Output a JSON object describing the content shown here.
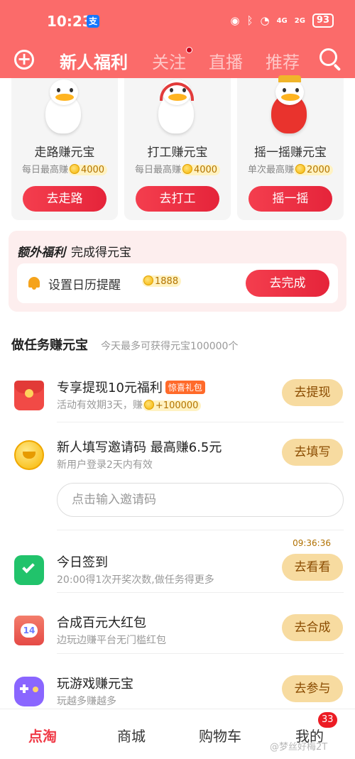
{
  "status_bar": {
    "time": "10:23",
    "alipay": "支",
    "signal_4g": "4G",
    "signal_2g": "2G",
    "battery": "93"
  },
  "nav": {
    "plus": "+",
    "tabs": [
      {
        "label": "新人福利",
        "active": true
      },
      {
        "label": "关注",
        "active": false
      },
      {
        "label": "直播",
        "active": false
      },
      {
        "label": "推荐",
        "active": false
      }
    ]
  },
  "cards": [
    {
      "title": "走路赚元宝",
      "sub_label": "每日最高赚",
      "amount": "4000",
      "button": "去走路"
    },
    {
      "title": "打工赚元宝",
      "sub_label": "每日最高赚",
      "amount": "4000",
      "button": "去打工"
    },
    {
      "title": "摇一摇赚元宝",
      "sub_label": "单次最高赚",
      "amount": "2000",
      "button": "摇一摇"
    }
  ],
  "extra": {
    "title": "额外福利",
    "subtitle": "完成得元宝",
    "task": "设置日历提醒",
    "amount": "1888",
    "button": "去完成"
  },
  "tasks_section": {
    "title": "做任务赚元宝",
    "subtitle": "今天最多可获得元宝100000个",
    "items": [
      {
        "title": "专享提现10元福利",
        "tag": "惊喜礼包",
        "sub": "活动有效期3天，赚",
        "amount": "+100000",
        "button": "去提现",
        "icon": "red-envelope-icon"
      },
      {
        "title": "新人填写邀请码 最高赚6.5元",
        "sub": "新用户登录2天内有效",
        "button": "去填写",
        "icon": "gold-ingot-icon"
      },
      {
        "title": "今日签到",
        "sub": "20:00得1次开奖次数,做任务得更多",
        "button": "去看看",
        "timer": "09:36:36",
        "icon": "calendar-check-icon"
      },
      {
        "title": "合成百元大红包",
        "sub": "边玩边赚平台无门槛红包",
        "button": "去合成",
        "icon": "red-packet-14-icon"
      },
      {
        "title": "玩游戏赚元宝",
        "sub": "玩越多赚越多",
        "button": "去参与",
        "icon": "gamepad-icon"
      }
    ],
    "invite_placeholder": "点击输入邀请码"
  },
  "bottom_nav": {
    "items": [
      {
        "label": "点淘",
        "active": true
      },
      {
        "label": "商城",
        "active": false
      },
      {
        "label": "购物车",
        "active": false
      },
      {
        "label": "我的",
        "active": false
      }
    ],
    "badge": "33",
    "watermark": "@梦丝好梅2T"
  },
  "colors": {
    "header": "#fb6b6a",
    "accent_red": "#f03a47",
    "task_button": "#f7dba0"
  }
}
